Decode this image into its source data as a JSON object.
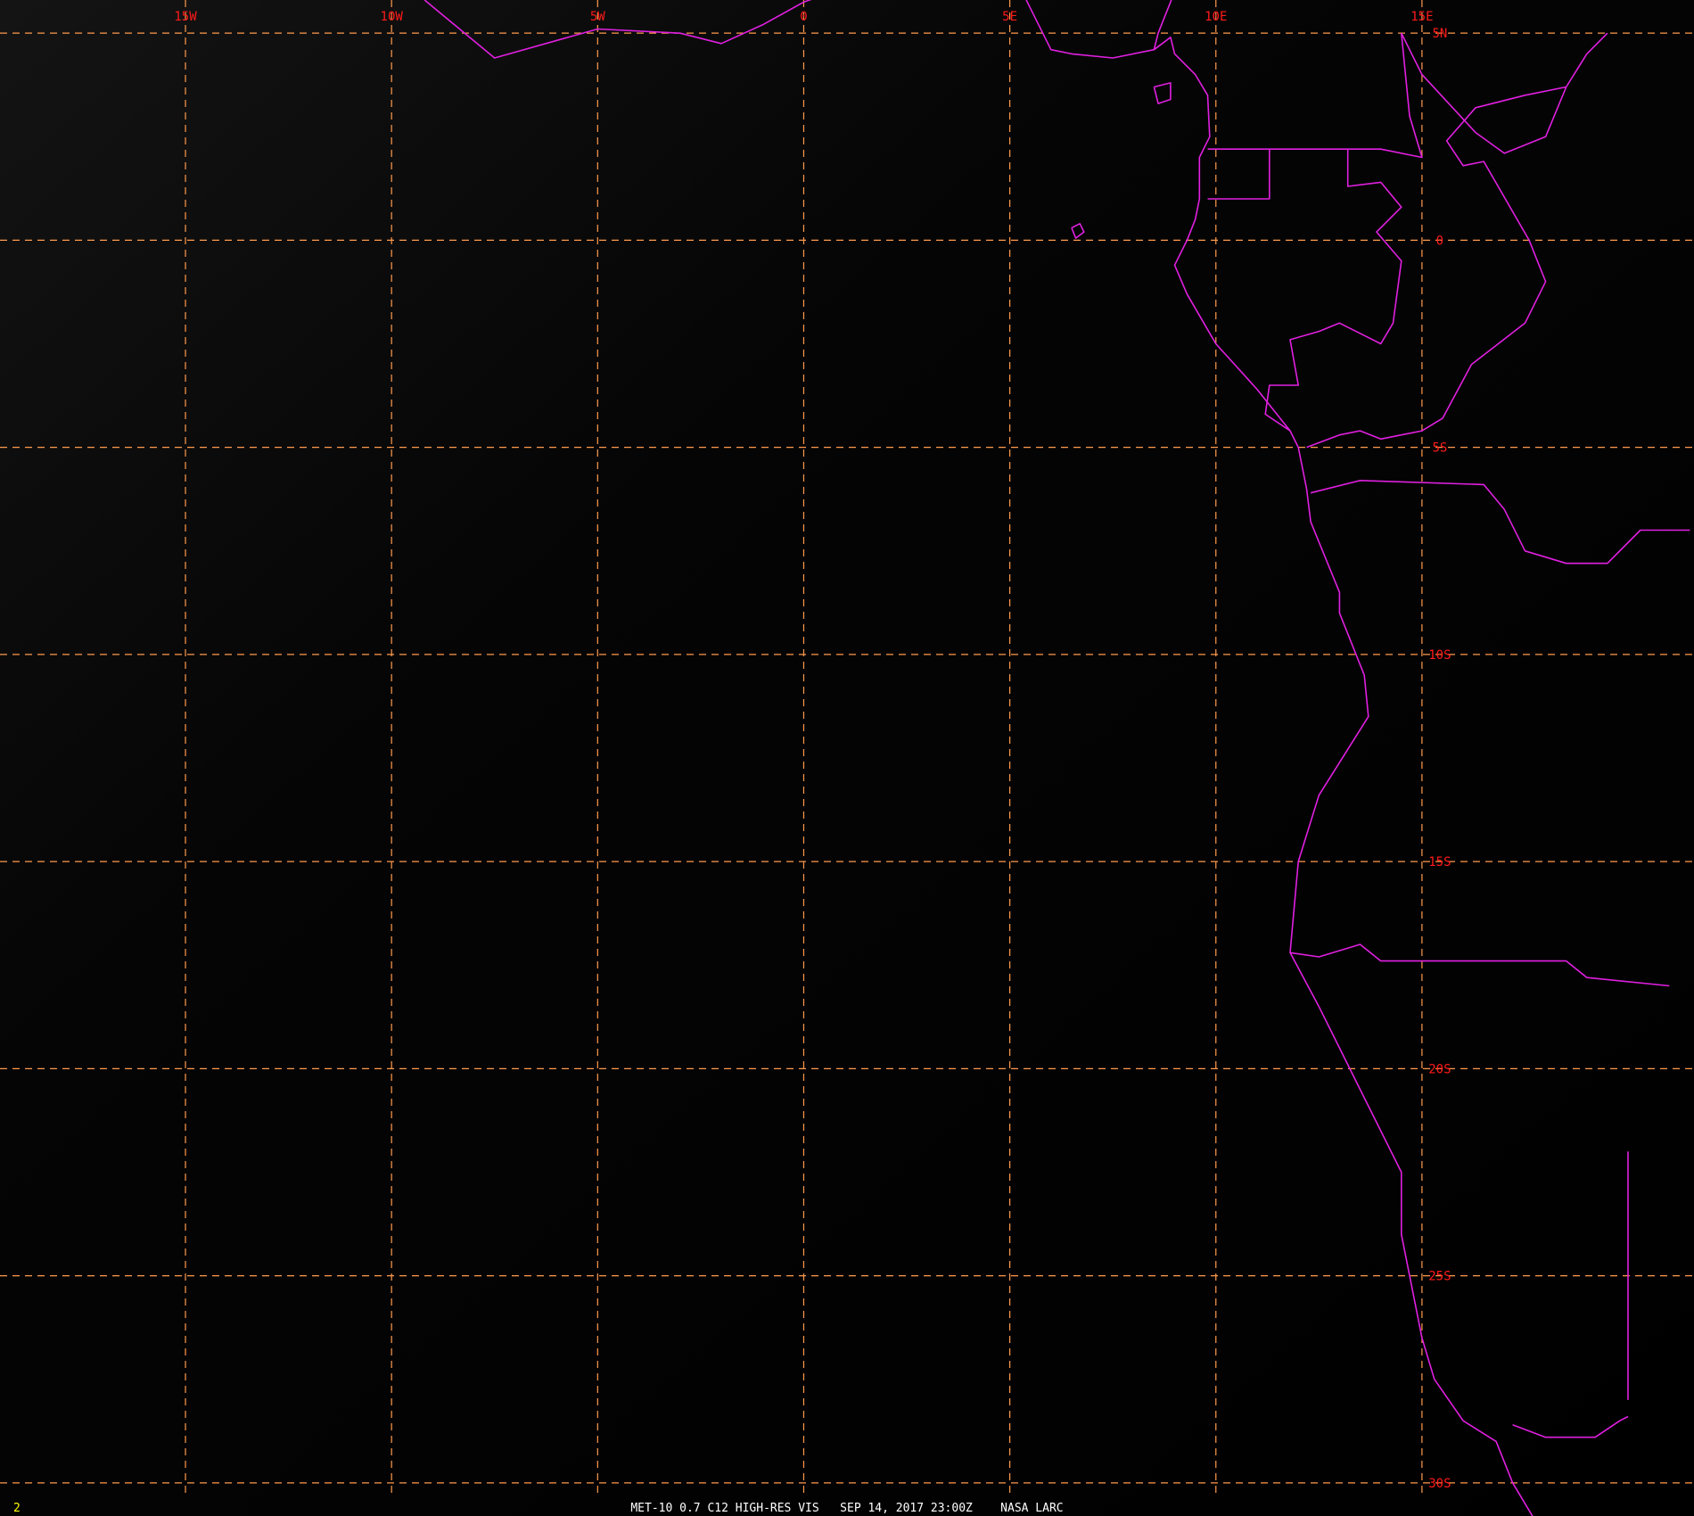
{
  "image": {
    "caption": "MET-10 0.7 C12 HIGH-RES VIS   SEP 14, 2017 23:00Z    NASA LARC",
    "frame_number": "2"
  },
  "colors": {
    "background": "#000000",
    "gridline": "#ff9a4d",
    "grid_label": "#ff1a1a",
    "coastline": "#e020e0",
    "caption": "#ffffff",
    "frame_number": "#ffff00"
  },
  "grid": {
    "longitudes": [
      {
        "value": -15,
        "label": "15W"
      },
      {
        "value": -10,
        "label": "10W"
      },
      {
        "value": -5,
        "label": "5W"
      },
      {
        "value": 0,
        "label": "0"
      },
      {
        "value": 5,
        "label": "5E"
      },
      {
        "value": 10,
        "label": "10E"
      },
      {
        "value": 15,
        "label": "15E"
      }
    ],
    "latitudes": [
      {
        "value": 5,
        "label": "5N"
      },
      {
        "value": 0,
        "label": "0"
      },
      {
        "value": -5,
        "label": "5S"
      },
      {
        "value": -10,
        "label": "10S"
      },
      {
        "value": -15,
        "label": "15S"
      },
      {
        "value": -20,
        "label": "20S"
      },
      {
        "value": -25,
        "label": "25S"
      },
      {
        "value": -30,
        "label": "30S"
      }
    ]
  },
  "coastlines": [
    {
      "name": "guinea-coast-west",
      "points": [
        [
          -9.2,
          5.8
        ],
        [
          -7.5,
          4.4
        ],
        [
          -5.0,
          5.1
        ],
        [
          -3.0,
          5.0
        ],
        [
          -2.0,
          4.75
        ],
        [
          -1.0,
          5.2
        ],
        [
          0.0,
          5.75
        ],
        [
          1.0,
          6.1
        ]
      ]
    },
    {
      "name": "bight-of-biafra-coast",
      "points": [
        [
          5.3,
          6.0
        ],
        [
          5.5,
          5.6
        ],
        [
          6.0,
          4.6
        ],
        [
          6.5,
          4.5
        ],
        [
          7.5,
          4.4
        ],
        [
          8.5,
          4.6
        ],
        [
          8.9,
          4.9
        ],
        [
          9.0,
          4.5
        ],
        [
          9.5,
          4.0
        ],
        [
          9.8,
          3.5
        ],
        [
          9.85,
          2.5
        ],
        [
          9.6,
          2.0
        ],
        [
          9.6,
          1.0
        ],
        [
          9.5,
          0.5
        ],
        [
          9.3,
          0.0
        ],
        [
          9.0,
          -0.6
        ],
        [
          9.3,
          -1.3
        ],
        [
          10.0,
          -2.5
        ],
        [
          11.0,
          -3.6
        ],
        [
          11.8,
          -4.6
        ],
        [
          12.0,
          -5.0
        ],
        [
          12.2,
          -6.0
        ],
        [
          12.3,
          -6.8
        ],
        [
          13.0,
          -8.5
        ],
        [
          13.0,
          -9.0
        ],
        [
          13.6,
          -10.5
        ],
        [
          13.7,
          -11.5
        ],
        [
          12.5,
          -13.4
        ],
        [
          12.0,
          -15.0
        ],
        [
          11.8,
          -17.2
        ],
        [
          12.5,
          -18.5
        ],
        [
          13.5,
          -20.5
        ],
        [
          14.5,
          -22.5
        ],
        [
          14.5,
          -24.0
        ],
        [
          15.0,
          -26.5
        ],
        [
          15.3,
          -27.5
        ],
        [
          16.0,
          -28.5
        ],
        [
          16.8,
          -29.0
        ],
        [
          17.2,
          -30.0
        ],
        [
          17.8,
          -31.0
        ]
      ]
    },
    {
      "name": "bioko-island",
      "points": [
        [
          8.5,
          3.7
        ],
        [
          8.9,
          3.8
        ],
        [
          8.9,
          3.4
        ],
        [
          8.6,
          3.3
        ],
        [
          8.5,
          3.7
        ]
      ]
    },
    {
      "name": "sao-tome-island",
      "points": [
        [
          6.5,
          0.3
        ],
        [
          6.7,
          0.4
        ],
        [
          6.8,
          0.2
        ],
        [
          6.6,
          0.05
        ],
        [
          6.5,
          0.3
        ]
      ]
    },
    {
      "name": "equatorial-guinea-border",
      "points": [
        [
          9.8,
          2.2
        ],
        [
          11.3,
          2.2
        ],
        [
          11.3,
          1.0
        ],
        [
          9.8,
          1.0
        ]
      ]
    },
    {
      "name": "gabon-congo-border",
      "points": [
        [
          11.3,
          2.2
        ],
        [
          13.2,
          2.2
        ],
        [
          13.2,
          1.3
        ],
        [
          14.0,
          1.4
        ],
        [
          14.5,
          0.8
        ],
        [
          13.9,
          0.2
        ],
        [
          14.5,
          -0.5
        ],
        [
          14.3,
          -2.0
        ],
        [
          14.0,
          -2.5
        ],
        [
          13.0,
          -2.0
        ],
        [
          12.5,
          -2.2
        ],
        [
          11.8,
          -2.4
        ],
        [
          12.0,
          -3.5
        ],
        [
          11.3,
          -3.5
        ],
        [
          11.2,
          -4.2
        ],
        [
          11.8,
          -4.6
        ]
      ]
    },
    {
      "name": "cabinda-border",
      "points": [
        [
          12.2,
          -5.0
        ],
        [
          13.0,
          -4.7
        ],
        [
          13.5,
          -4.6
        ],
        [
          14.0,
          -4.8
        ],
        [
          14.5,
          -4.7
        ]
      ]
    },
    {
      "name": "drc-angola-border",
      "points": [
        [
          12.3,
          -6.1
        ],
        [
          13.5,
          -5.8
        ],
        [
          16.5,
          -5.9
        ],
        [
          17.0,
          -6.5
        ],
        [
          17.5,
          -7.5
        ],
        [
          18.5,
          -7.8
        ],
        [
          19.5,
          -7.8
        ],
        [
          20.3,
          -7.0
        ],
        [
          21.5,
          -7.0
        ]
      ]
    },
    {
      "name": "angola-namibia-border",
      "points": [
        [
          11.8,
          -17.2
        ],
        [
          12.5,
          -17.3
        ],
        [
          13.5,
          -17.0
        ],
        [
          14.0,
          -17.4
        ],
        [
          17.0,
          -17.4
        ],
        [
          18.5,
          -17.4
        ],
        [
          19.0,
          -17.8
        ],
        [
          21.0,
          -18.0
        ]
      ]
    },
    {
      "name": "namibia-botswana-border",
      "points": [
        [
          20.0,
          -22.0
        ],
        [
          20.0,
          -28.0
        ]
      ]
    },
    {
      "name": "orange-river-border",
      "points": [
        [
          17.2,
          -28.6
        ],
        [
          18.0,
          -28.9
        ],
        [
          19.2,
          -28.9
        ],
        [
          19.8,
          -28.5
        ],
        [
          20.0,
          -28.4
        ]
      ]
    },
    {
      "name": "congo-interior-border",
      "points": [
        [
          18.5,
          3.7
        ],
        [
          17.5,
          3.5
        ],
        [
          16.3,
          3.2
        ],
        [
          15.6,
          2.4
        ],
        [
          16.0,
          1.8
        ],
        [
          16.5,
          1.9
        ],
        [
          17.6,
          0.0
        ],
        [
          18.0,
          -1.0
        ],
        [
          17.5,
          -2.0
        ],
        [
          16.2,
          -3.0
        ],
        [
          15.5,
          -4.3
        ],
        [
          15.0,
          -4.6
        ],
        [
          14.5,
          -4.7
        ]
      ]
    },
    {
      "name": "cameroon-car-border",
      "points": [
        [
          14.5,
          5.0
        ],
        [
          15.0,
          4.0
        ],
        [
          16.3,
          2.6
        ],
        [
          17.0,
          2.1
        ],
        [
          18.0,
          2.5
        ],
        [
          18.5,
          3.7
        ],
        [
          19.0,
          4.5
        ],
        [
          19.5,
          5.0
        ]
      ]
    },
    {
      "name": "cameroon-border",
      "points": [
        [
          14.5,
          5.0
        ],
        [
          14.7,
          3.0
        ],
        [
          15.0,
          2.0
        ],
        [
          14.0,
          2.2
        ],
        [
          13.2,
          2.2
        ]
      ]
    },
    {
      "name": "nigeria-cameroon-border",
      "points": [
        [
          8.5,
          4.6
        ],
        [
          8.6,
          5.0
        ],
        [
          9.0,
          6.0
        ],
        [
          9.5,
          6.5
        ],
        [
          10.5,
          6.9
        ]
      ]
    },
    {
      "name": "benin-nigeria-border",
      "points": [
        [
          2.7,
          6.4
        ],
        [
          2.8,
          8.0
        ]
      ]
    }
  ],
  "map_view": {
    "lon_range": [
      -19.5,
      21.6
    ],
    "lat_range": [
      -30.8,
      5.8
    ]
  }
}
